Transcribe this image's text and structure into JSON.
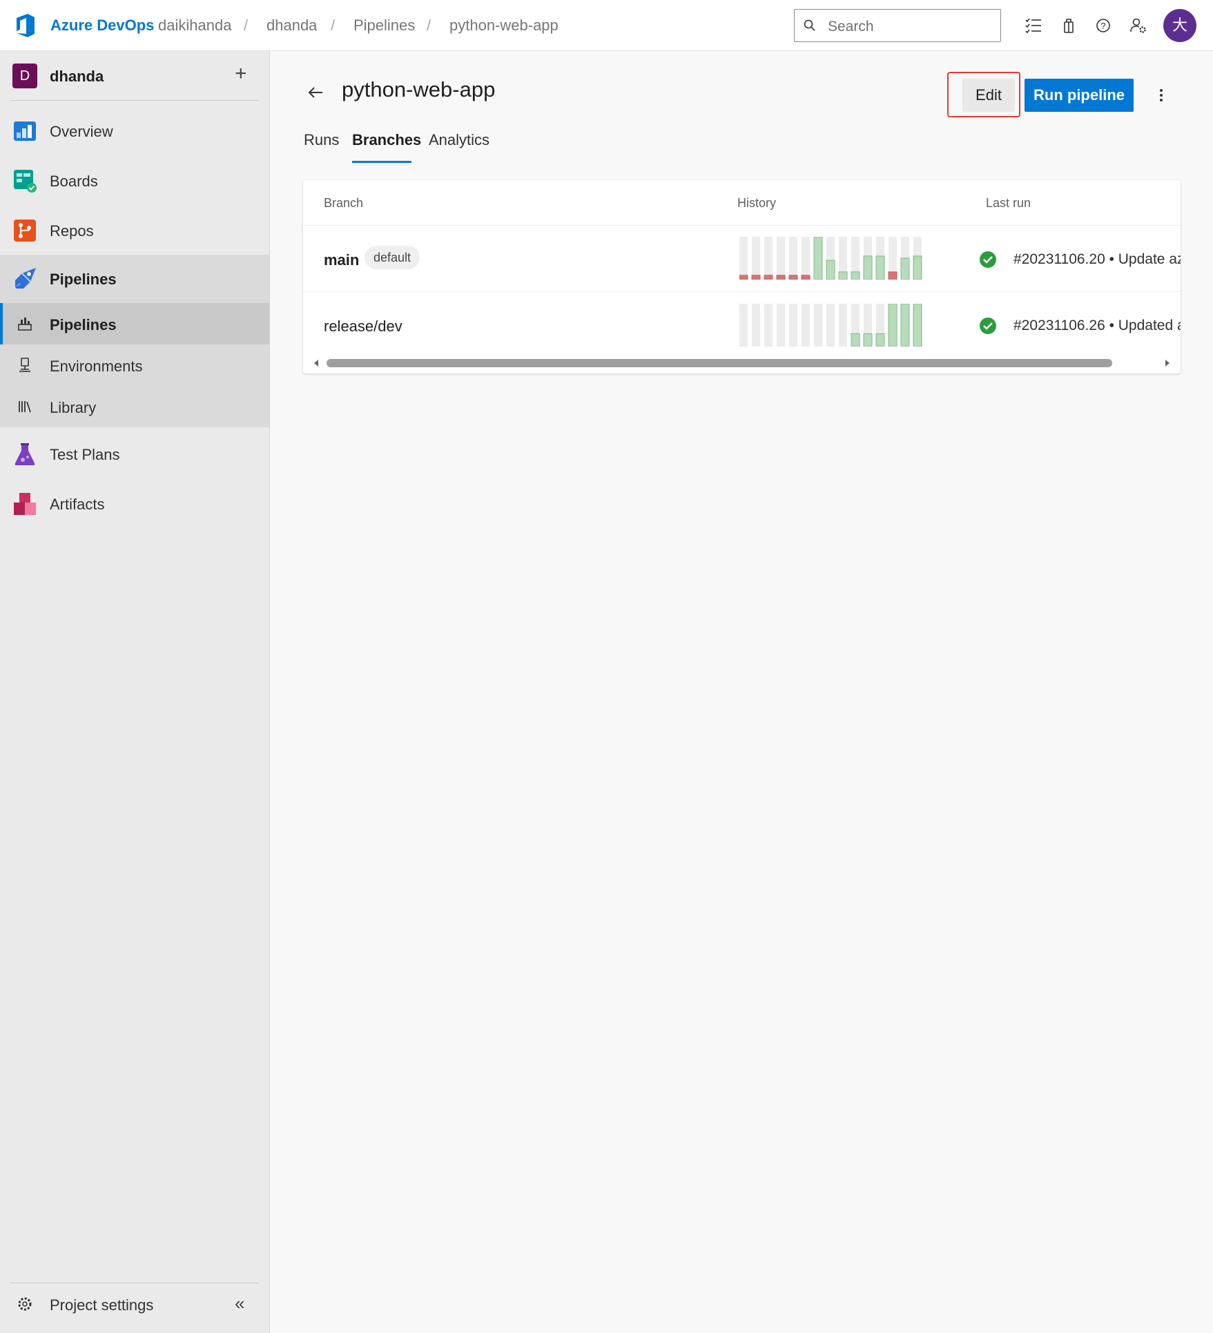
{
  "header": {
    "brand": "Azure DevOps",
    "breadcrumbs": [
      "daikihanda",
      "dhanda",
      "Pipelines",
      "python-web-app"
    ],
    "search_placeholder": "Search",
    "avatar_initial": "大",
    "icons": [
      "task-list-icon",
      "shopping-bag-icon",
      "help-icon",
      "user-settings-icon"
    ]
  },
  "sidebar": {
    "project_initial": "D",
    "project_name": "dhanda",
    "items": [
      {
        "label": "Overview",
        "icon": "overview-icon"
      },
      {
        "label": "Boards",
        "icon": "boards-icon"
      },
      {
        "label": "Repos",
        "icon": "repos-icon"
      },
      {
        "label": "Pipelines",
        "icon": "pipelines-icon"
      },
      {
        "label": "Test Plans",
        "icon": "test-plans-icon"
      },
      {
        "label": "Artifacts",
        "icon": "artifacts-icon"
      }
    ],
    "subitems": [
      {
        "label": "Pipelines",
        "icon": "pipelines-sub-icon"
      },
      {
        "label": "Environments",
        "icon": "environments-icon"
      },
      {
        "label": "Library",
        "icon": "library-icon"
      }
    ],
    "settings_label": "Project settings"
  },
  "page": {
    "title": "python-web-app",
    "edit_label": "Edit",
    "run_label": "Run pipeline",
    "tabs": [
      "Runs",
      "Branches",
      "Analytics"
    ],
    "selected_tab": "Branches"
  },
  "table": {
    "columns": [
      "Branch",
      "History",
      "Last run"
    ],
    "rows": [
      {
        "branch": "main",
        "badge": "default",
        "last_run": "#20231106.20 • Update az",
        "history": [
          {
            "status": "failed",
            "level": 0.1
          },
          {
            "status": "failed",
            "level": 0.1
          },
          {
            "status": "failed",
            "level": 0.1
          },
          {
            "status": "failed",
            "level": 0.1
          },
          {
            "status": "failed",
            "level": 0.1
          },
          {
            "status": "failed",
            "level": 0.1
          },
          {
            "status": "succeeded",
            "level": 1.0
          },
          {
            "status": "succeeded",
            "level": 0.45
          },
          {
            "status": "succeeded",
            "level": 0.18
          },
          {
            "status": "succeeded",
            "level": 0.18
          },
          {
            "status": "succeeded",
            "level": 0.55
          },
          {
            "status": "succeeded",
            "level": 0.55
          },
          {
            "status": "failed",
            "level": 0.18
          },
          {
            "status": "succeeded",
            "level": 0.5
          },
          {
            "status": "succeeded",
            "level": 0.55
          }
        ]
      },
      {
        "branch": "release/dev",
        "badge": "",
        "last_run": "#20231106.26 • Updated a",
        "history": [
          {
            "status": "none",
            "level": 0
          },
          {
            "status": "none",
            "level": 0
          },
          {
            "status": "none",
            "level": 0
          },
          {
            "status": "none",
            "level": 0
          },
          {
            "status": "none",
            "level": 0
          },
          {
            "status": "none",
            "level": 0
          },
          {
            "status": "none",
            "level": 0
          },
          {
            "status": "none",
            "level": 0
          },
          {
            "status": "none",
            "level": 0
          },
          {
            "status": "succeeded",
            "level": 0.3
          },
          {
            "status": "succeeded",
            "level": 0.3
          },
          {
            "status": "succeeded",
            "level": 0.3
          },
          {
            "status": "succeeded",
            "level": 1.0
          },
          {
            "status": "succeeded",
            "level": 1.0
          },
          {
            "status": "succeeded",
            "level": 1.0
          }
        ]
      }
    ]
  },
  "colors": {
    "accent": "#0078d4",
    "success": "#107c10",
    "failed_bar": "#d87474",
    "success_bar": "#b8dbbc",
    "empty_bar": "#ececec",
    "highlight_outline": "#e53935"
  }
}
